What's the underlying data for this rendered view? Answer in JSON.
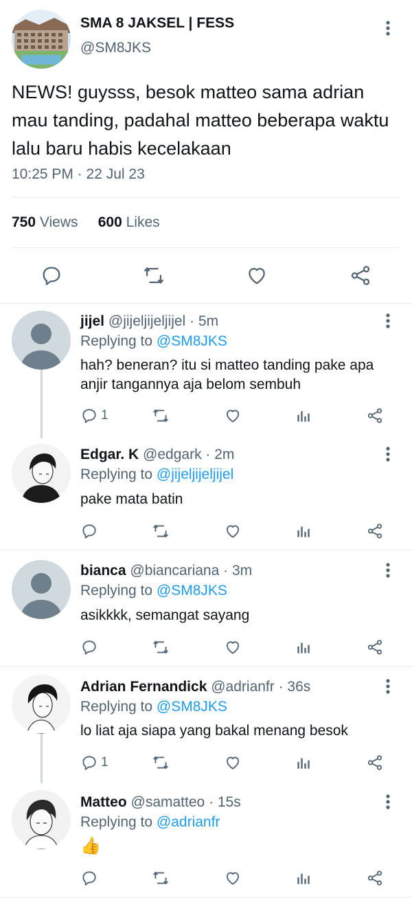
{
  "main_tweet": {
    "name": "SMA 8 JAKSEL | FESS",
    "handle": "@SM8JKS",
    "text": "NEWS! guysss, besok matteo sama adrian mau tanding, padahal matteo beberapa waktu lalu baru habis kecelakaan",
    "timestamp": "10:25 PM · 22 Jul 23",
    "views_count": "750",
    "views_label": "Views",
    "likes_count": "600",
    "likes_label": "Likes"
  },
  "replies": [
    {
      "name": "jijel",
      "handle": "@jijeljijeljijel",
      "time": "· 5m",
      "replying_prefix": "Replying to",
      "replying_to": "@SM8JKS",
      "text": "hah? beneran? itu si matteo tanding pake apa anjir tangannya aja belom sembuh",
      "reply_count": "1"
    },
    {
      "name": "Edgar. K",
      "handle": "@edgark",
      "time": "· 2m",
      "replying_prefix": "Replying to",
      "replying_to": "@jijeljijeljijel",
      "text": "pake mata batin",
      "reply_count": ""
    },
    {
      "name": "bianca",
      "handle": "@biancariana",
      "time": "· 3m",
      "replying_prefix": "Replying to",
      "replying_to": "@SM8JKS",
      "text": "asikkkk, semangat sayang",
      "reply_count": ""
    },
    {
      "name": "Adrian Fernandick",
      "handle": "@adrianfr",
      "time": "· 36s",
      "replying_prefix": "Replying to",
      "replying_to": "@SM8JKS",
      "text": "lo liat aja siapa yang bakal menang besok",
      "reply_count": "1"
    },
    {
      "name": "Matteo",
      "handle": "@samatteo",
      "time": "· 15s",
      "replying_prefix": "Replying to",
      "replying_to": "@adrianfr",
      "text": "👍",
      "reply_count": ""
    }
  ],
  "colors": {
    "accent": "#1d9bf0",
    "secondary_text": "#536471",
    "icon": "#536471",
    "divider": "#e6ecf0"
  }
}
